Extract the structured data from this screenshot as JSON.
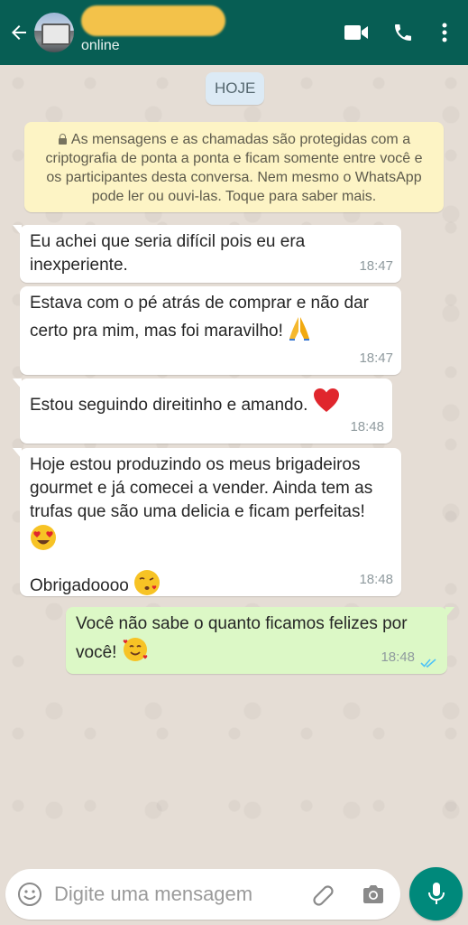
{
  "header": {
    "contact_name": "",
    "status": "online"
  },
  "chat": {
    "date_label": "HOJE",
    "encryption_notice": "As mensagens e as chamadas são protegidas com a criptografia de ponta a ponta e ficam somente entre você e os participantes desta conversa. Nem mesmo o WhatsApp pode ler ou ouvi-las. Toque para saber mais.",
    "messages": [
      {
        "direction": "in",
        "text": "Eu achei que seria difícil pois eu era inexperiente.",
        "time": "18:47"
      },
      {
        "direction": "in",
        "text": "Estava com o pé atrás de comprar e não dar certo pra mim, mas foi maravilho!",
        "emoji": "folded-hands",
        "time": "18:47"
      },
      {
        "direction": "in",
        "text": "Estou seguindo direitinho e amando.",
        "emoji": "red-heart",
        "time": "18:48"
      },
      {
        "direction": "in",
        "text": "Hoje estou produzindo os meus brigadeiros gourmet e já comecei a vender. Ainda tem as trufas que são uma delicia e ficam perfeitas!",
        "emoji": "heart-eyes",
        "text2": "Obrigadoooo",
        "emoji2": "kissing-heart",
        "time": "18:48"
      },
      {
        "direction": "out",
        "text": "Você não sabe o quanto ficamos felizes por você!",
        "emoji": "smiling-hearts",
        "time": "18:48",
        "status": "read"
      }
    ]
  },
  "input": {
    "placeholder": "Digite uma mensagem"
  },
  "colors": {
    "header": "#075e54",
    "wallpaper": "#e5ddd5",
    "outgoing_bubble": "#dcf8c6",
    "read_ticks": "#4fc3f7",
    "mic_button": "#00897b"
  }
}
